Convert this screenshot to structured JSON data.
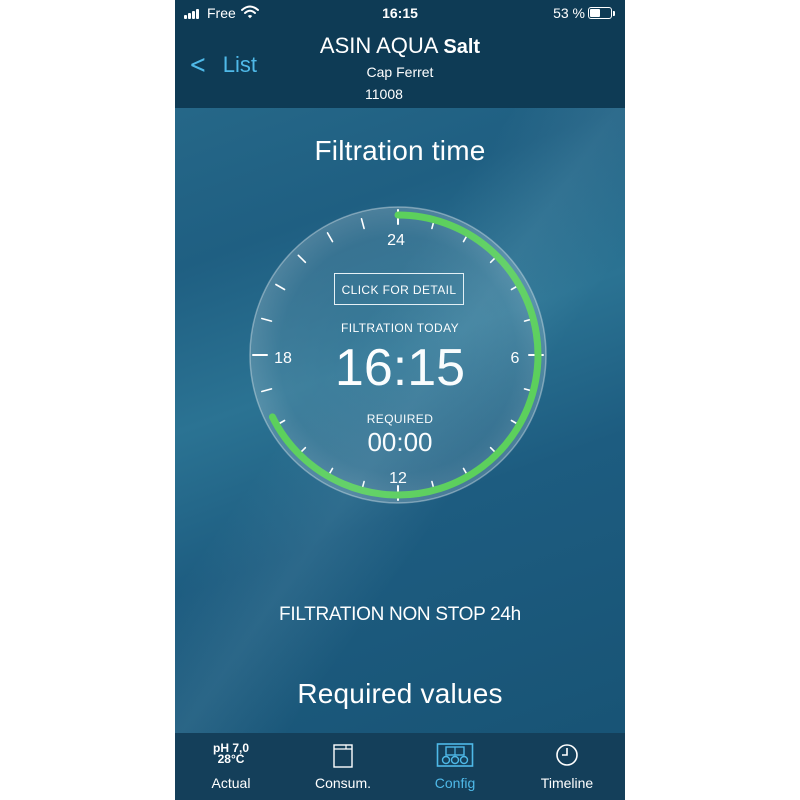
{
  "status_bar": {
    "carrier": "Free",
    "time": "16:15",
    "battery": "53 %",
    "battery_level": 0.53
  },
  "header": {
    "back_label": "List",
    "title_main": "ASIN AQUA",
    "title_bold": "Salt",
    "subtitle": "Cap Ferret",
    "code": "11008"
  },
  "filtration": {
    "title": "Filtration time",
    "detail_button": "CLICK FOR DETAIL",
    "today_label": "FILTRATION TODAY",
    "today_value": "16:15",
    "required_label": "REQUIRED",
    "required_value": "00:00",
    "hour_labels": {
      "top": "24",
      "right": "6",
      "bottom": "12",
      "left": "18"
    },
    "progress_hours": 16.25,
    "mode_text": "FILTRATION NON STOP 24h"
  },
  "required_values": {
    "title": "Required values"
  },
  "tabbar": {
    "ph_label": "pH 7,0",
    "temp_label": "28°C",
    "tabs": [
      {
        "label": "Actual",
        "icon": "ph-temp-icon"
      },
      {
        "label": "Consum.",
        "icon": "container-icon"
      },
      {
        "label": "Config",
        "icon": "device-config-icon",
        "active": true
      },
      {
        "label": "Timeline",
        "icon": "clock-icon"
      }
    ]
  },
  "colors": {
    "accent": "#4fb9e8",
    "progress": "#5cd05c",
    "header_bg": "#0e3b55",
    "tabbar_bg": "#143f5a"
  }
}
